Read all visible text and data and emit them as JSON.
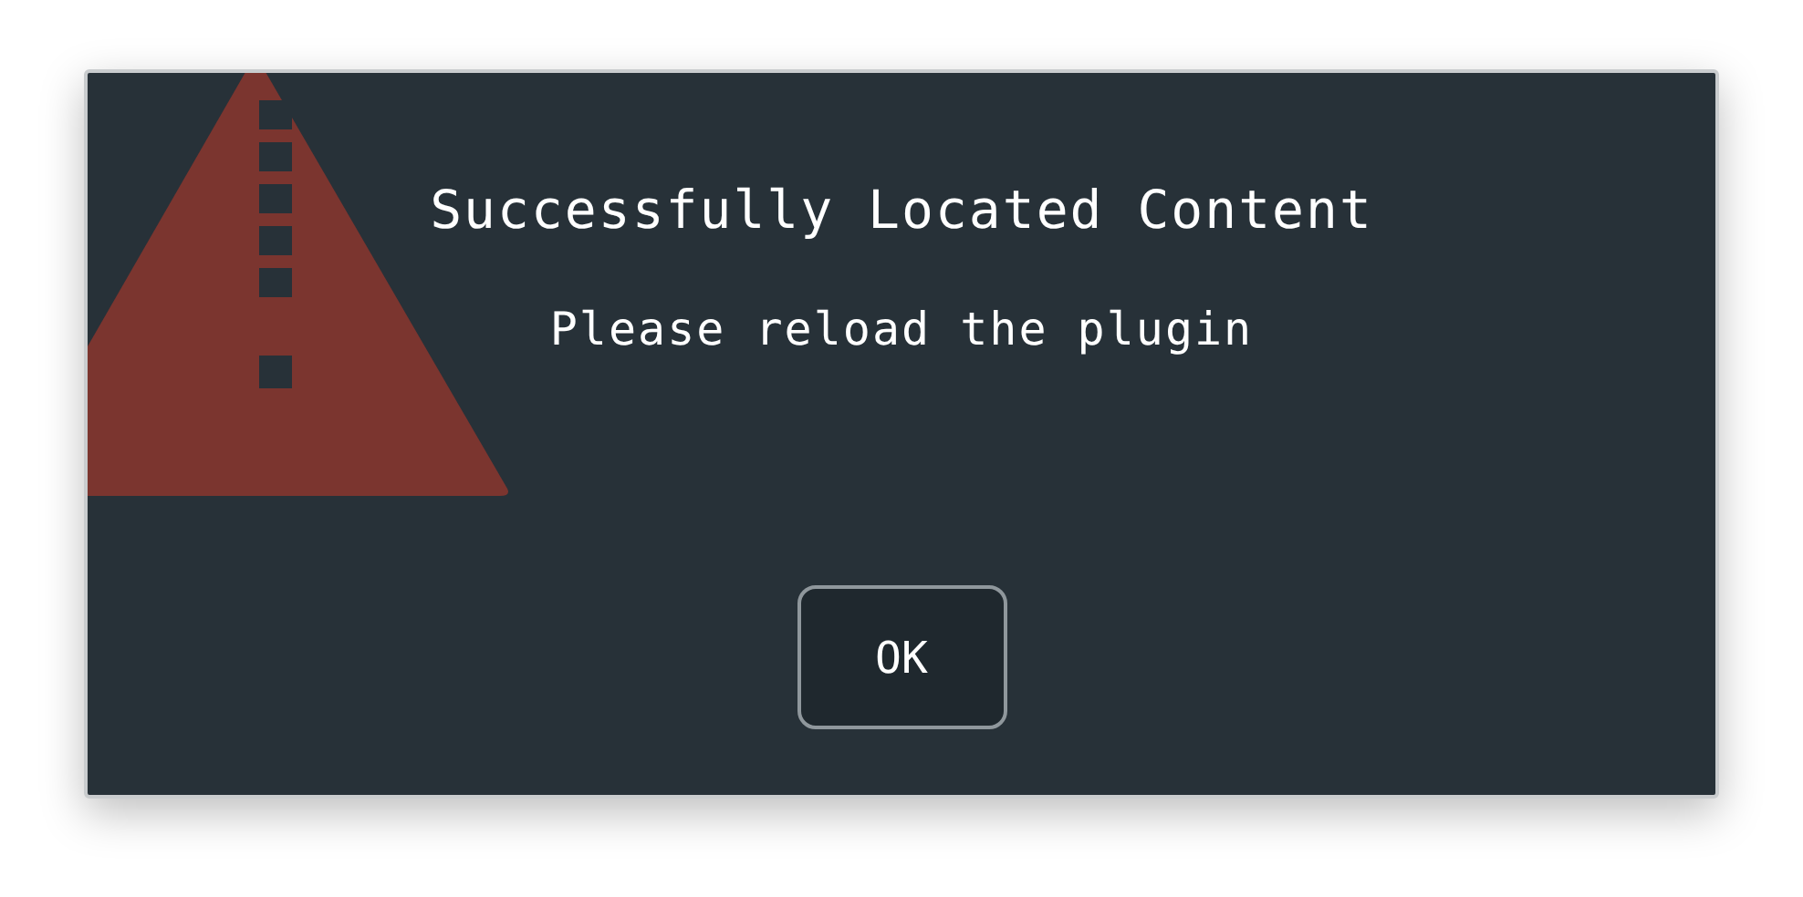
{
  "dialog": {
    "title": "Successfully Located Content",
    "message": "Please reload the plugin",
    "buttons": [
      "OK"
    ]
  }
}
